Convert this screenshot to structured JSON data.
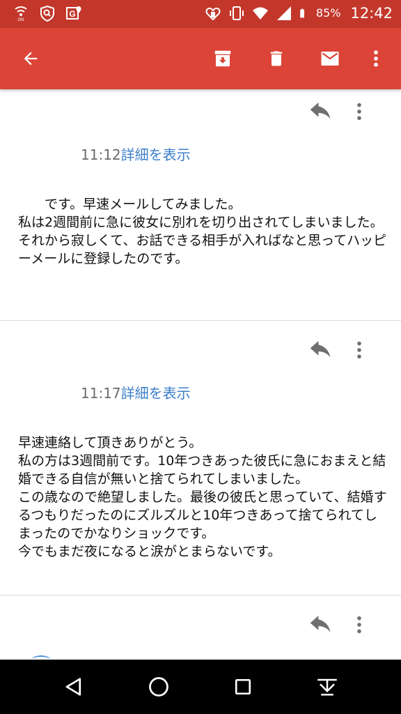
{
  "status_bar": {
    "left_icons": [
      "wifi-calling-icon",
      "security-shield-icon",
      "location-g-icon"
    ],
    "right_icons": [
      "heart-phone-icon",
      "vibrate-icon",
      "wifi-icon",
      "signal-icon",
      "battery-icon"
    ],
    "battery": "85%",
    "time": "12:42",
    "color": "#c3372b"
  },
  "app_bar": {
    "color": "#db4437",
    "actions": [
      "back-arrow-icon",
      "archive-icon",
      "delete-icon",
      "mark-unread-icon",
      "more-vert-icon"
    ]
  },
  "messages": [
    {
      "time": "11:12",
      "details_link": "詳細を表示",
      "body": "　　です。早速メールしてみました。\n私は2週間前に急に彼女に別れを切り出されてしまいました。\nそれから寂しくて、お話できる相手が入ればなと思ってハッピーメールに登録したのです。"
    },
    {
      "time": "11:17",
      "details_link": "詳細を表示",
      "body": "早速連絡して頂きありがとう。\n私の方は3週間前です。10年つきあった彼氏に急におまえと結婚できる自信が無いと捨てられてしまいました。\nこの歳なので絶望しました。最後の彼氏と思っていて、結婚するつもりだったのにズルズルと10年つきあって捨てられてしまったのでかなりショックです。\n今でもまだ夜になると涙がとまらないです。"
    }
  ],
  "link_color": "#3a7dc9",
  "nav_bar": {
    "buttons": [
      "back-triangle-icon",
      "home-circle-icon",
      "recents-square-icon",
      "hide-keyboard-icon"
    ]
  }
}
